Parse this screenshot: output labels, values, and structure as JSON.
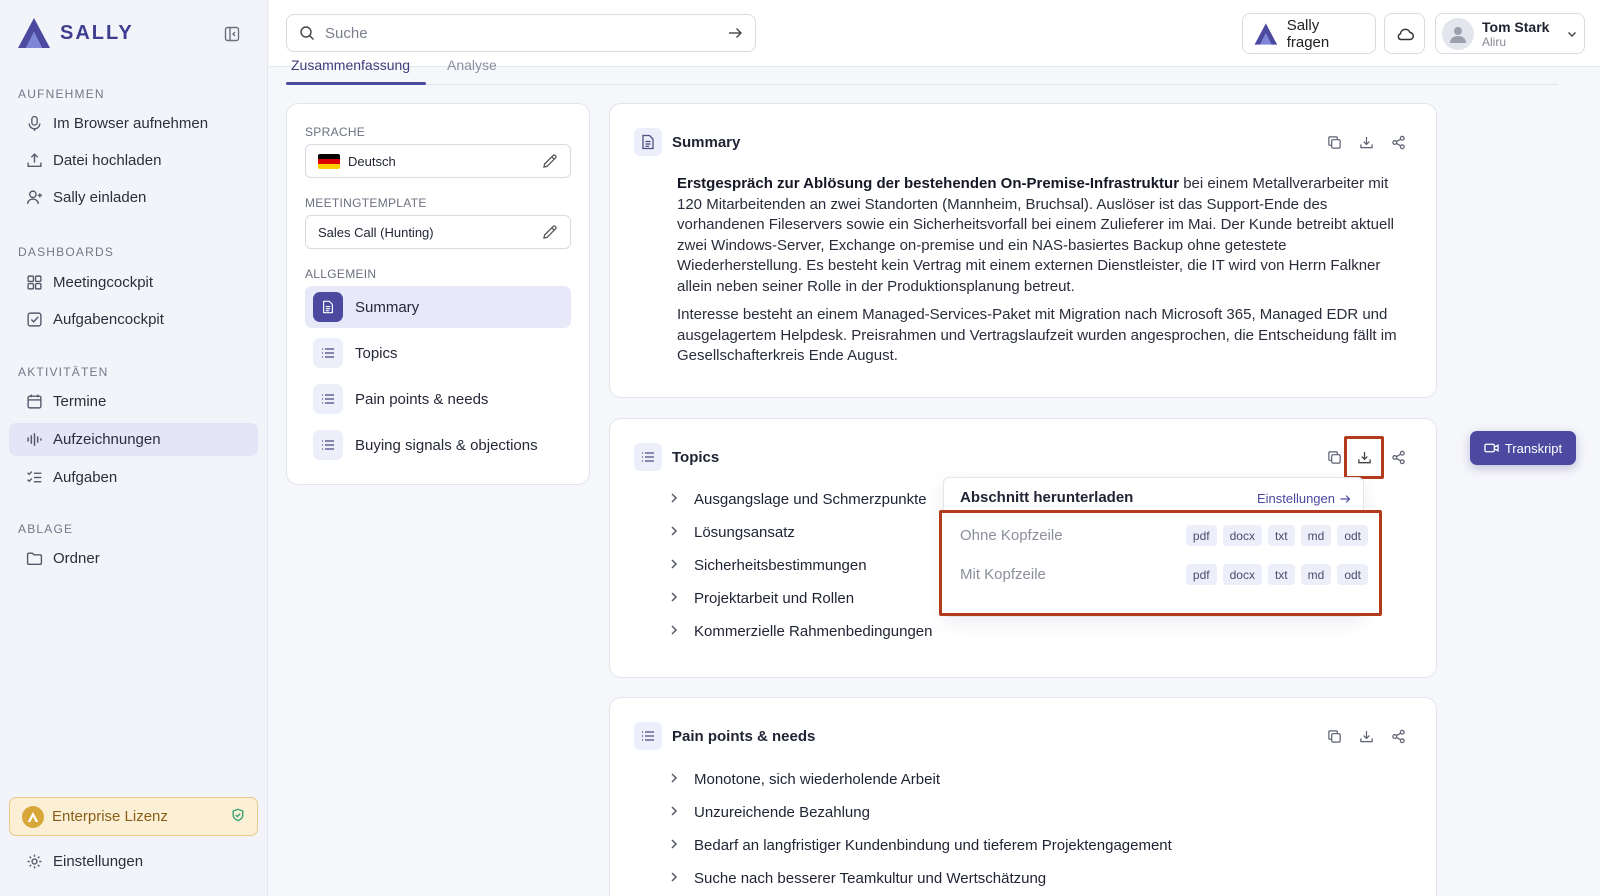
{
  "app": {
    "logo_text": "SALLY"
  },
  "sidebar": {
    "sections": [
      {
        "label": "AUFNEHMEN"
      },
      {
        "label": "DASHBOARDS"
      },
      {
        "label": "AKTIVITÄTEN"
      },
      {
        "label": "ABLAGE"
      }
    ],
    "items": [
      {
        "label": "Im Browser aufnehmen",
        "icon": "microphone-icon"
      },
      {
        "label": "Datei hochladen",
        "icon": "upload-icon"
      },
      {
        "label": "Sally einladen",
        "icon": "user-plus-icon"
      },
      {
        "label": "Meetingcockpit",
        "icon": "grid-icon"
      },
      {
        "label": "Aufgabencockpit",
        "icon": "checkbox-icon"
      },
      {
        "label": "Termine",
        "icon": "calendar-icon"
      },
      {
        "label": "Aufzeichnungen",
        "icon": "waveform-icon",
        "active": true
      },
      {
        "label": "Aufgaben",
        "icon": "checklist-icon"
      },
      {
        "label": "Ordner",
        "icon": "folder-icon"
      }
    ],
    "license": "Enterprise Lizenz",
    "settings": "Einstellungen"
  },
  "header": {
    "search_placeholder": "Suche",
    "ask_label": "Sally fragen",
    "user_name": "Tom Stark",
    "user_org": "Aliru"
  },
  "tabs": [
    {
      "label": "Zusammenfassung",
      "active": true
    },
    {
      "label": "Analyse"
    }
  ],
  "settings_panel": {
    "language_label": "SPRACHE",
    "language_value": "Deutsch",
    "template_label": "MEETINGTEMPLATE",
    "template_value": "Sales Call (Hunting)",
    "general_label": "ALLGEMEIN",
    "sections": [
      {
        "label": "Summary",
        "active": true
      },
      {
        "label": "Topics"
      },
      {
        "label": "Pain points & needs"
      },
      {
        "label": "Buying signals & objections"
      }
    ]
  },
  "summary_card": {
    "title": "Summary",
    "p1_bold": "Erstgespräch zur Ablösung der bestehenden On-Premise-Infrastruktur",
    "p1_rest": " bei einem Metallverarbeiter mit 120 Mitarbeitenden an zwei Standorten (Mannheim, Bruchsal). Auslöser ist das Support-Ende des vorhandenen Fileservers sowie ein Sicherheitsvorfall bei einem Zulieferer im Mai. Der Kunde betreibt aktuell zwei Windows-Server, Exchange on-premise und ein NAS-basiertes Backup ohne getestete Wiederherstellung. Es besteht kein Vertrag mit einem externen Dienstleister, die IT wird von Herrn Falkner allein neben seiner Rolle in der Produktionsplanung betreut.",
    "p2": "Interesse besteht an einem Managed-Services-Paket mit Migration nach Microsoft 365, Managed EDR und ausgelagertem Helpdesk. Preisrahmen und Vertragslaufzeit wurden angesprochen, die Entscheidung fällt im Gesellschafterkreis Ende August."
  },
  "topics_card": {
    "title": "Topics",
    "items": [
      "Ausgangslage und Schmerzpunkte",
      "Lösungsansatz",
      "Sicherheitsbestimmungen",
      "Projektarbeit und Rollen",
      "Kommerzielle Rahmenbedingungen"
    ]
  },
  "download_menu": {
    "title": "Abschnitt herunterladen",
    "settings_link": "Einstellungen",
    "rows": [
      {
        "label": "Ohne Kopfzeile",
        "formats": [
          "pdf",
          "docx",
          "txt",
          "md",
          "odt"
        ]
      },
      {
        "label": "Mit Kopfzeile",
        "formats": [
          "pdf",
          "docx",
          "txt",
          "md",
          "odt"
        ]
      }
    ]
  },
  "pain_card": {
    "title": "Pain points & needs",
    "items": [
      "Monotone, sich wiederholende Arbeit",
      "Unzureichende Bezahlung",
      "Bedarf an langfristiger Kundenbindung und tieferem Projektengagement",
      "Suche nach besserer Teamkultur und Wertschätzung"
    ]
  },
  "transcript_button": "Transkript",
  "colors": {
    "accent": "#4b4aa0",
    "highlight": "#b23b1b",
    "license_bg": "#fbf0d6"
  }
}
